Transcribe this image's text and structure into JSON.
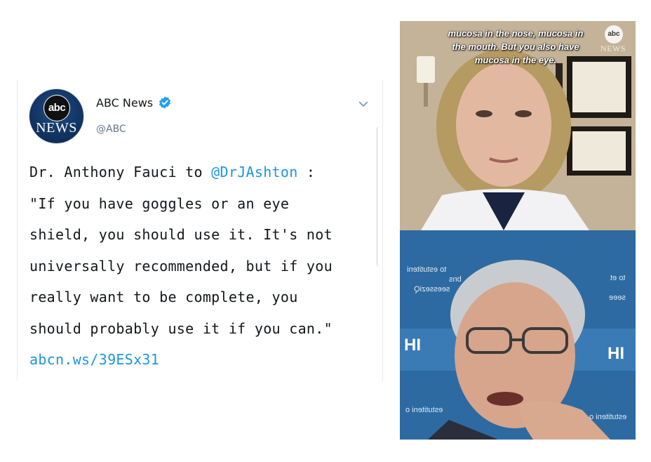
{
  "tweet": {
    "display_name": "ABC News",
    "handle": "@ABC",
    "avatar": {
      "disc_text": "abc",
      "brand_text": "NEWS"
    },
    "body_lines": [
      {
        "before": "Dr. Anthony Fauci to ",
        "mention": "@DrJAshton",
        "after": " :"
      },
      {
        "text": "\"If you have goggles or an eye"
      },
      {
        "text": "shield, you should use it. It's not"
      },
      {
        "text": "universally recommended, but if you"
      },
      {
        "text": "really want to be complete, you"
      },
      {
        "text": "should probably use it if you can.\""
      }
    ],
    "link": "abcn.ws/39ESx31",
    "icons": {
      "verified": "verified-badge-icon",
      "menu": "chevron-down-icon"
    }
  },
  "video": {
    "top": {
      "caption_lines": [
        "mucosa in the nose, mucosa in",
        "the mouth. But you also have",
        "mucosa in the eye."
      ],
      "bug_text": "abc",
      "bug_sub": "NEWS"
    },
    "bottom": {
      "backdrop_texts": [
        "to estutiteni",
        "bns",
        "seesseziQ",
        "estutiteni o",
        "to et",
        "seee",
        "estutiteni o"
      ],
      "hi_left": "HI",
      "hi_right": "HI"
    }
  },
  "colors": {
    "link": "#1b95e0",
    "text": "#14171a",
    "muted": "#657786",
    "verified": "#1da1f2"
  }
}
